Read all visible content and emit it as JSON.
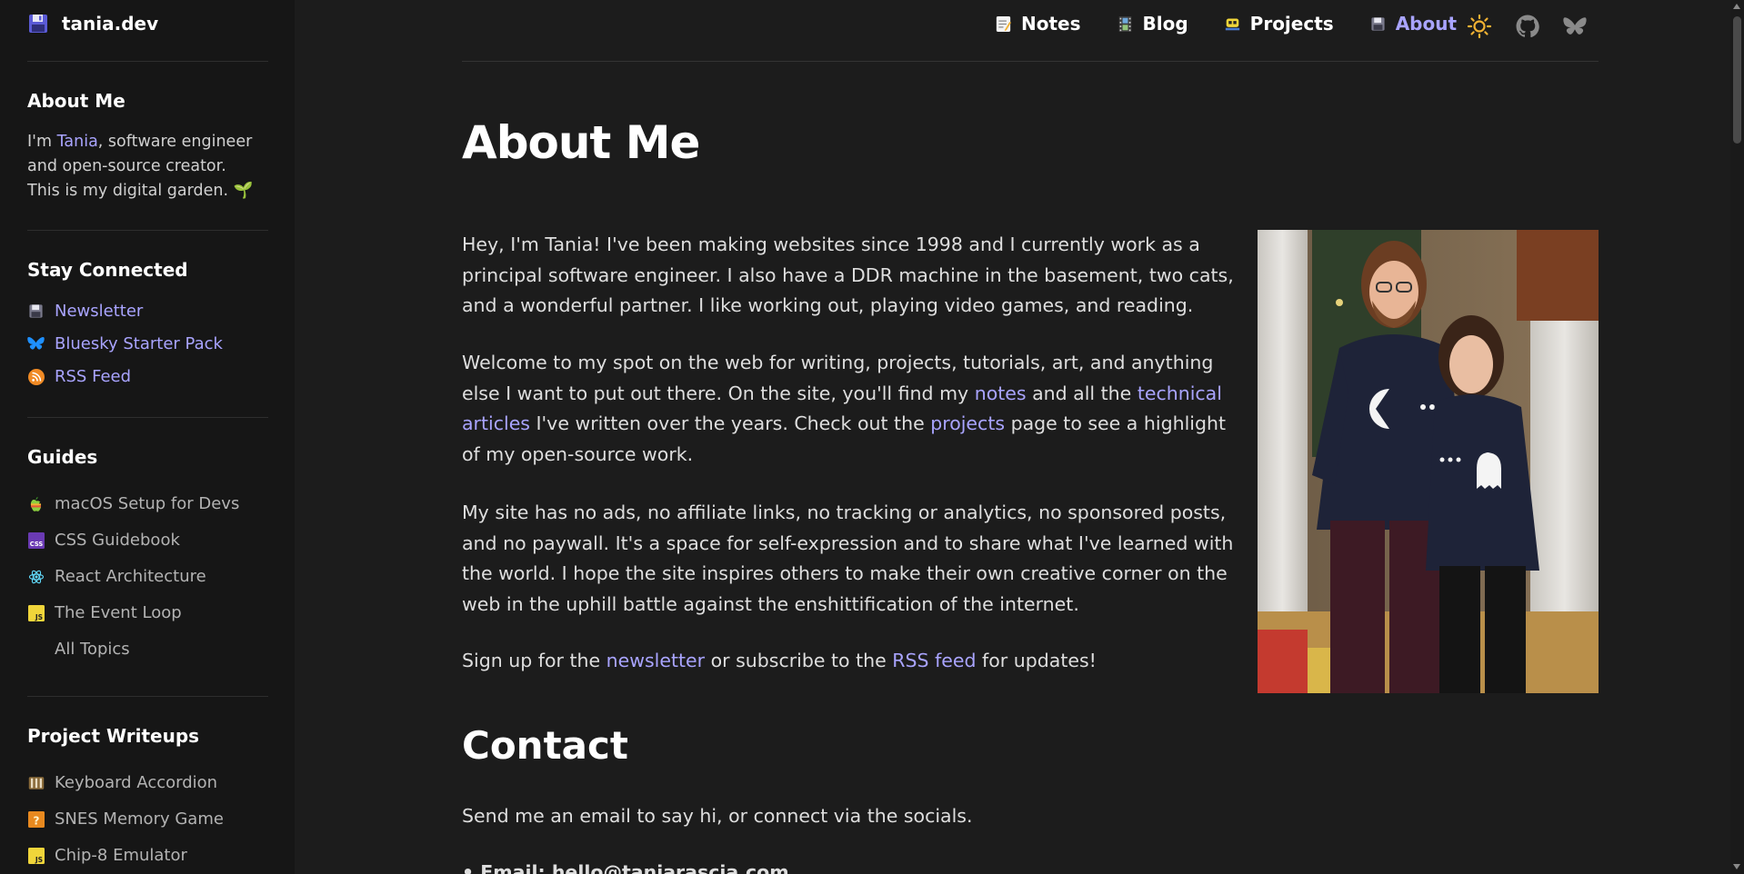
{
  "brand": {
    "name": "tania.dev",
    "icon": "floppy-disk-icon"
  },
  "sidebar": {
    "about": {
      "heading": "About Me",
      "text_pre": "I'm ",
      "text_link": "Tania",
      "text_post": ", software engineer and open-source creator. This is my digital garden. 🌱"
    },
    "connected": {
      "heading": "Stay Connected",
      "items": [
        {
          "label": "Newsletter",
          "icon": "floppy-disk-icon"
        },
        {
          "label": "Bluesky Starter Pack",
          "icon": "bluesky-butterfly-icon"
        },
        {
          "label": "RSS Feed",
          "icon": "rss-icon"
        }
      ]
    },
    "guides": {
      "heading": "Guides",
      "items": [
        {
          "label": "macOS Setup for Devs",
          "icon": "apple-icon"
        },
        {
          "label": "CSS Guidebook",
          "icon": "css-icon"
        },
        {
          "label": "React Architecture",
          "icon": "react-atom-icon"
        },
        {
          "label": "The Event Loop",
          "icon": "javascript-icon"
        },
        {
          "label": "All Topics",
          "icon": ""
        }
      ]
    },
    "projects": {
      "heading": "Project Writeups",
      "items": [
        {
          "label": "Keyboard Accordion",
          "icon": "accordion-icon"
        },
        {
          "label": "SNES Memory Game",
          "icon": "question-block-icon"
        },
        {
          "label": "Chip-8 Emulator",
          "icon": "javascript-icon"
        }
      ]
    }
  },
  "nav": {
    "items": [
      {
        "label": "Notes",
        "icon": "memo-icon"
      },
      {
        "label": "Blog",
        "icon": "film-frames-icon"
      },
      {
        "label": "Projects",
        "icon": "space-invader-icon"
      },
      {
        "label": "About",
        "icon": "floppy-disk-icon",
        "active": true
      }
    ],
    "actions": [
      "theme-toggle-sun-icon",
      "github-icon",
      "bluesky-icon"
    ]
  },
  "main": {
    "title": "About Me",
    "p1": "Hey, I'm Tania! I've been making websites since 1998 and I currently work as a principal software engineer. I also have a DDR machine in the basement, two cats, and a wonderful partner. I like working out, playing video games, and reading.",
    "p2": {
      "t1": "Welcome to my spot on the web for writing, projects, tutorials, art, and anything else I want to put out there. On the site, you'll find my ",
      "link1": "notes",
      "t2": " and all the ",
      "link2": "technical articles",
      "t3": " I've written over the years. Check out the ",
      "link3": "projects",
      "t4": " page to see a highlight of my open-source work."
    },
    "p3": "My site has no ads, no affiliate links, no tracking or analytics, no sponsored posts, and no paywall. It's a space for self-expression and to share what I've learned with the world. I hope the site inspires others to make their own creative corner on the web in the uphill battle against the enshittification of the internet.",
    "p4": {
      "t1": "Sign up for the ",
      "link1": "newsletter",
      "t2": " or subscribe to the ",
      "link2": "RSS feed",
      "t3": " for updates!"
    },
    "contact_title": "Contact",
    "contact_text": "Send me an email to say hi, or connect via the socials.",
    "contact_email_partial": "• Email: hello@taniarascia.com"
  },
  "colors": {
    "accent": "#a9a4ff",
    "background": "#1c1c1c",
    "sidebar": "#161616"
  }
}
